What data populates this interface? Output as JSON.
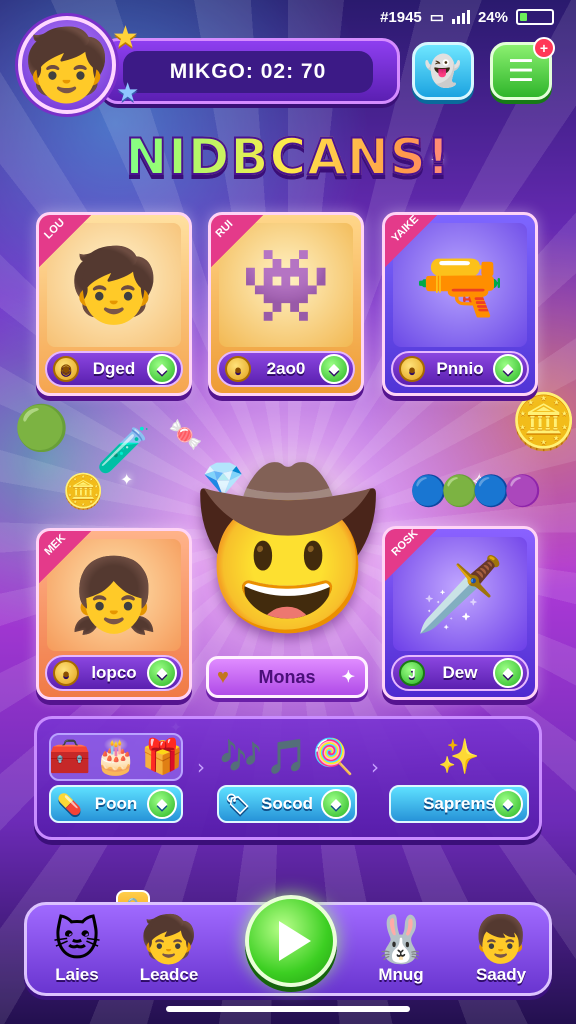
{
  "status_bar": {
    "time": "#1945",
    "battery": "24%",
    "battery_level": 0.24
  },
  "header": {
    "score_text": "MIKGO: 02:  70"
  },
  "title": "NIDBCANS!",
  "cards": [
    {
      "ribbon": "LOU",
      "label": "Dged",
      "art": "🧒"
    },
    {
      "ribbon": "RUI",
      "label": "2ao0",
      "art": "👾"
    },
    {
      "ribbon": "YAIKE",
      "label": "Pnnio",
      "art": "🔫"
    },
    {
      "ribbon": "MEK",
      "label": "lopco",
      "art": "👧"
    },
    {
      "ribbon": "ROSK",
      "label": "Dew",
      "art": "🗡️"
    }
  ],
  "hero": {
    "label": "Monas",
    "art": "🤠"
  },
  "items": [
    {
      "label": "Poon",
      "icons": [
        "🧰",
        "🎂",
        "🎁"
      ]
    },
    {
      "label": "Socod",
      "icons": [
        "🎶",
        "🎵",
        "🍭"
      ]
    },
    {
      "label": "Saprems",
      "icons": [
        "✨"
      ]
    }
  ],
  "bottom_nav": [
    {
      "label": "Laies",
      "face": "🐱"
    },
    {
      "label": "Leadce",
      "face": "🧒"
    },
    {
      "label": "Mnug",
      "face": "🐰"
    },
    {
      "label": "Saady",
      "face": "👦"
    }
  ]
}
